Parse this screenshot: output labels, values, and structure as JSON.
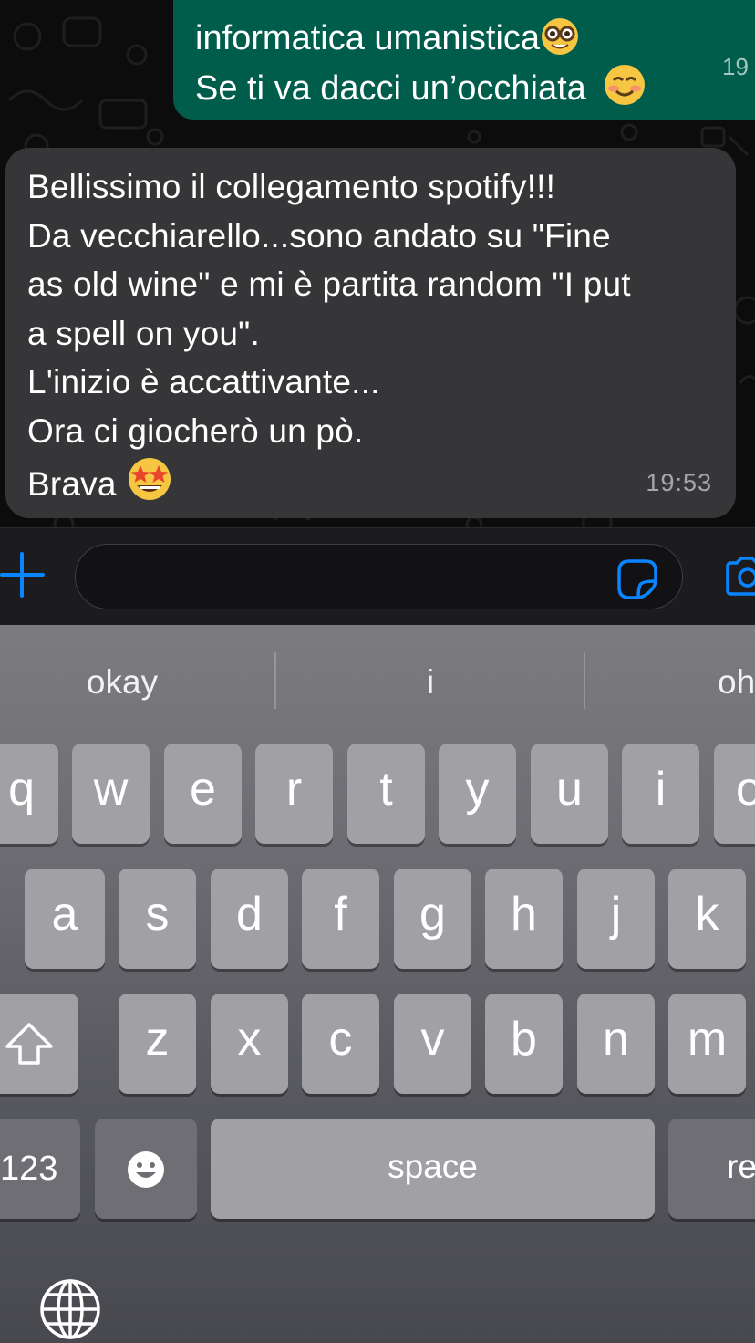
{
  "chat": {
    "outgoing": {
      "lines": [
        "informatica umanistica",
        "Se ti va dacci un’occhiata"
      ],
      "emojis": [
        "nerd-face-emoji",
        "smiling-face-emoji"
      ],
      "time": "19"
    },
    "incoming": {
      "text": "Bellissimo il collegamento spotify!!!\nDa vecchiarello...sono andato su \"Fine\nas old wine\" e mi è partita random \"I put\na spell on you\".\nL'inizio è accattivante...\nOra ci giocherò un pò.\nBrava",
      "emoji": "star-struck-emoji",
      "time": "19:53"
    }
  },
  "input_bar": {
    "icons": [
      "plus-icon",
      "sticker-icon",
      "camera-icon"
    ],
    "accent": "#0a84ff",
    "value": ""
  },
  "keyboard": {
    "suggestions": [
      "okay",
      "i",
      "oh"
    ],
    "row1": [
      "q",
      "w",
      "e",
      "r",
      "t",
      "y",
      "u",
      "i",
      "o"
    ],
    "row2": [
      "a",
      "s",
      "d",
      "f",
      "g",
      "h",
      "j",
      "k"
    ],
    "row3": [
      "z",
      "x",
      "c",
      "v",
      "b",
      "n",
      "m"
    ],
    "numbers_label": "123",
    "space_label": "space",
    "return_label": "re",
    "icons": [
      "shift-icon",
      "emoji-icon",
      "globe-icon"
    ]
  }
}
